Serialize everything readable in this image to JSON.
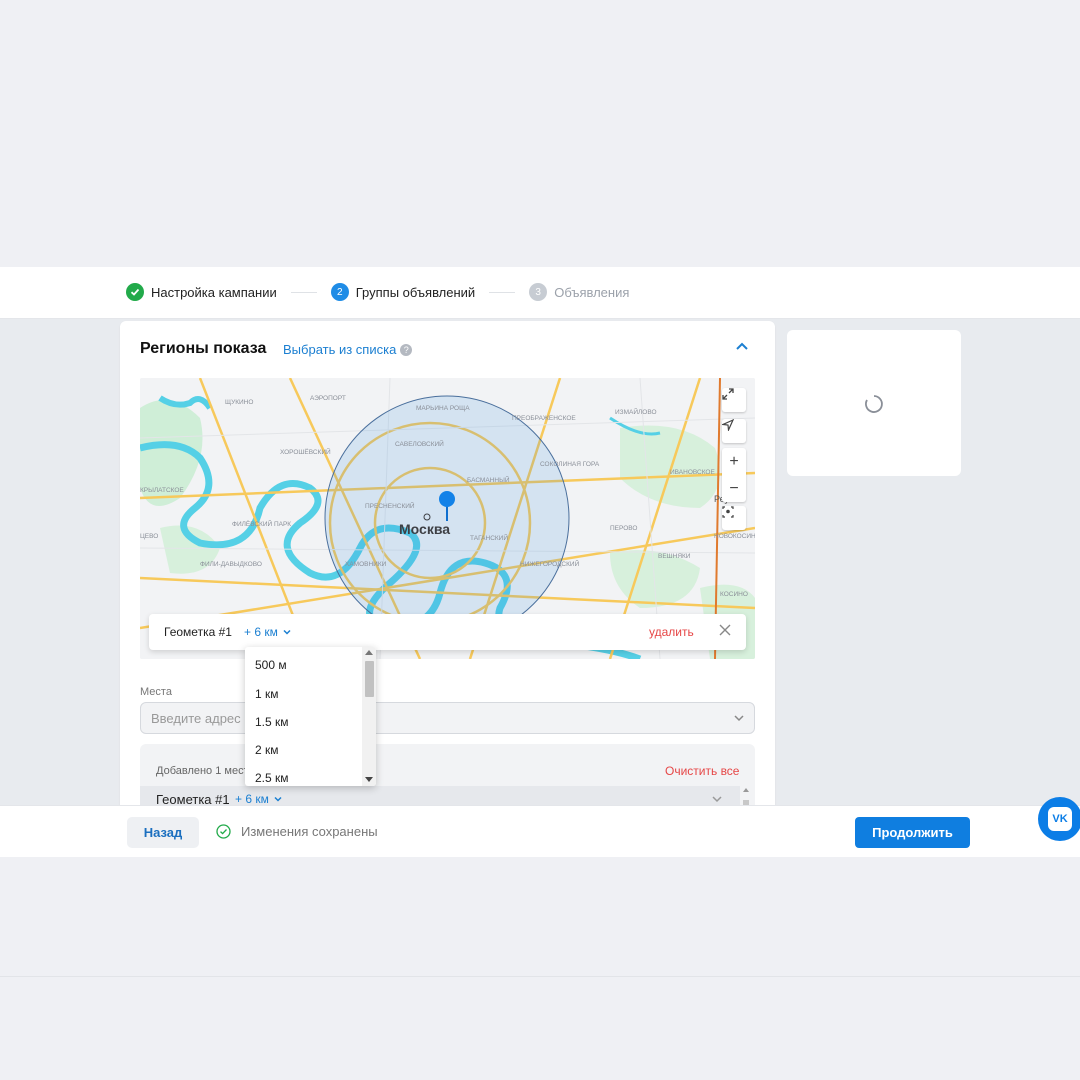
{
  "stepper": {
    "steps": [
      {
        "label": "Настройка кампании",
        "state": "done",
        "marker": ""
      },
      {
        "label": "Группы объявлений",
        "state": "active",
        "marker": "2"
      },
      {
        "label": "Объявления",
        "state": "inactive",
        "marker": "3"
      }
    ]
  },
  "regions": {
    "title": "Регионы показа",
    "choose_link": "Выбрать из списка",
    "help_icon": "?"
  },
  "map": {
    "city_label": "Москва",
    "district_labels": [
      "ЩУКИНО",
      "АЭРОПОРТ",
      "МАРЬИНА РОЩА",
      "ПРЕОБРАЖЕНСКОЕ",
      "ИЗМАЙЛОВО",
      "ХОРОШЁВСКИЙ",
      "САВЕЛОВСКИЙ",
      "БАСМАННЫЙ",
      "СОКОЛИНАЯ ГОРА",
      "ИВАНОВСКОЕ",
      "КРЫЛАТСКОЕ",
      "ФИЛЁВСКИЙ ПАРК",
      "ПЕРОВО",
      "ТАГАНСКИЙ",
      "ФИЛИ-ДАВЫДКОВО",
      "ХАМОВНИКИ",
      "НИЖЕГОРОДСКИЙ",
      "ВЕШНЯКИ",
      "НОВОКОСИНО",
      "КОСИНО",
      "Реутов",
      "ПРЕСНЕНСКИЙ",
      "ЦЕВО"
    ],
    "controls": {
      "zoom_in": "+",
      "zoom_out": "−"
    },
    "circle_color": "#3b8fe0"
  },
  "geo_bar": {
    "name": "Геометка #1",
    "radius": "+ 6 км",
    "delete": "удалить"
  },
  "radius_dropdown": {
    "options": [
      "500 м",
      "1 км",
      "1.5 км",
      "2 км",
      "2.5 км"
    ]
  },
  "places": {
    "label": "Места",
    "placeholder": "Введите адрес или"
  },
  "added": {
    "label": "Добавлено 1 место",
    "clear_all": "Очистить все",
    "row_name": "Геометка #1",
    "row_radius": "+ 6 км"
  },
  "footer": {
    "back": "Назад",
    "saved_status": "Изменения сохранены",
    "continue": "Продолжить"
  },
  "vk_badge": "VK",
  "colors": {
    "accent": "#0f7ee0",
    "link": "#1b7fd1",
    "danger": "#e64646",
    "success": "#22aa4a"
  }
}
